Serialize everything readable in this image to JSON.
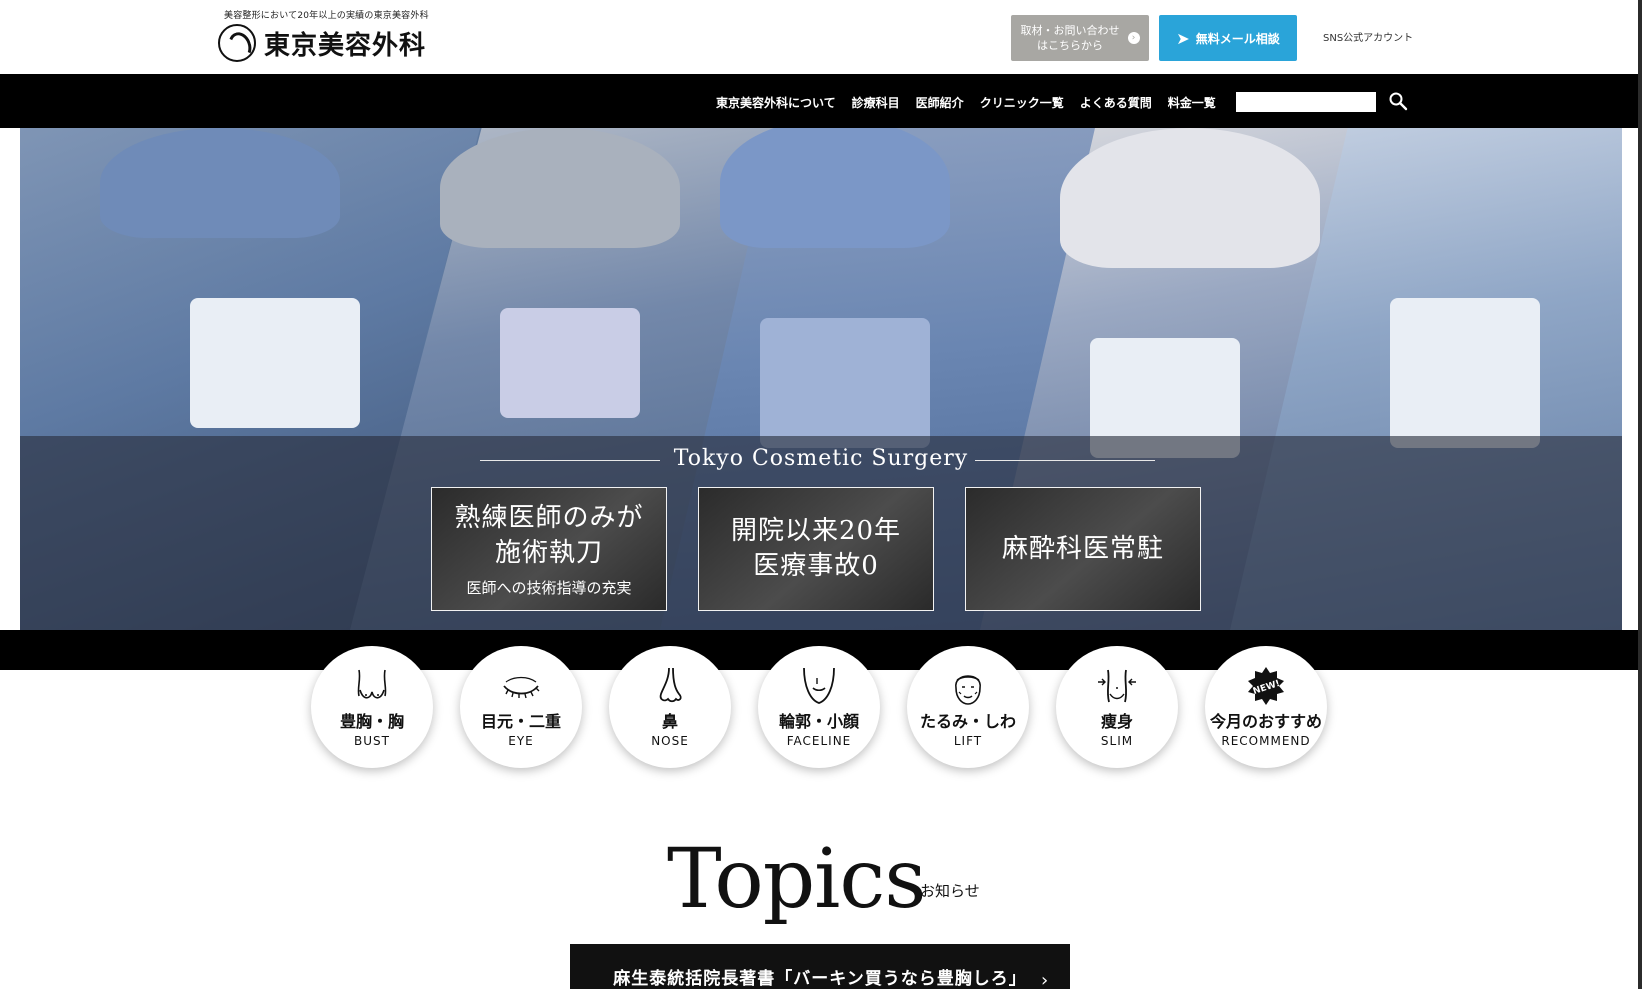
{
  "header": {
    "tagline": "美容整形において20年以上の実績の東京美容外科",
    "logo_text": "東京美容外科",
    "contact_button": {
      "line1": "取材・お問い合わせ",
      "line2": "はこちらから"
    },
    "mail_button": "無料メール相談",
    "sns_link": "SNS公式アカウント"
  },
  "nav": {
    "items": [
      "東京美容外科について",
      "診療科目",
      "医師紹介",
      "クリニック一覧",
      "よくある質問",
      "料金一覧"
    ],
    "search_placeholder": ""
  },
  "hero": {
    "title": "Tokyo Cosmetic Surgery",
    "features": [
      {
        "main": "熟練医師のみが\n施術執刀",
        "sub": "医師への技術指導の充実"
      },
      {
        "main": "開院以来20年\n医療事故0",
        "sub": ""
      },
      {
        "main": "麻酔科医常駐",
        "sub": ""
      }
    ]
  },
  "categories": [
    {
      "jp": "豊胸・胸",
      "en": "BUST",
      "icon": "bust-icon"
    },
    {
      "jp": "目元・二重",
      "en": "EYE",
      "icon": "eye-icon"
    },
    {
      "jp": "鼻",
      "en": "NOSE",
      "icon": "nose-icon"
    },
    {
      "jp": "輪郭・小顔",
      "en": "FACELINE",
      "icon": "faceline-icon"
    },
    {
      "jp": "たるみ・しわ",
      "en": "LIFT",
      "icon": "lift-icon"
    },
    {
      "jp": "痩身",
      "en": "SLIM",
      "icon": "slim-icon"
    },
    {
      "jp": "今月のおすすめ",
      "en": "RECOMMEND",
      "icon": "new-badge-icon",
      "badge": "NEW!"
    }
  ],
  "topics": {
    "title": "Topics",
    "subtitle": "お知らせ",
    "headline": "麻生泰統括院長著書「バーキン買うなら豊胸しろ」"
  },
  "colors": {
    "nav_bg": "#000000",
    "mail_button": "#2aa4d9",
    "contact_button": "#a8a7a3"
  }
}
